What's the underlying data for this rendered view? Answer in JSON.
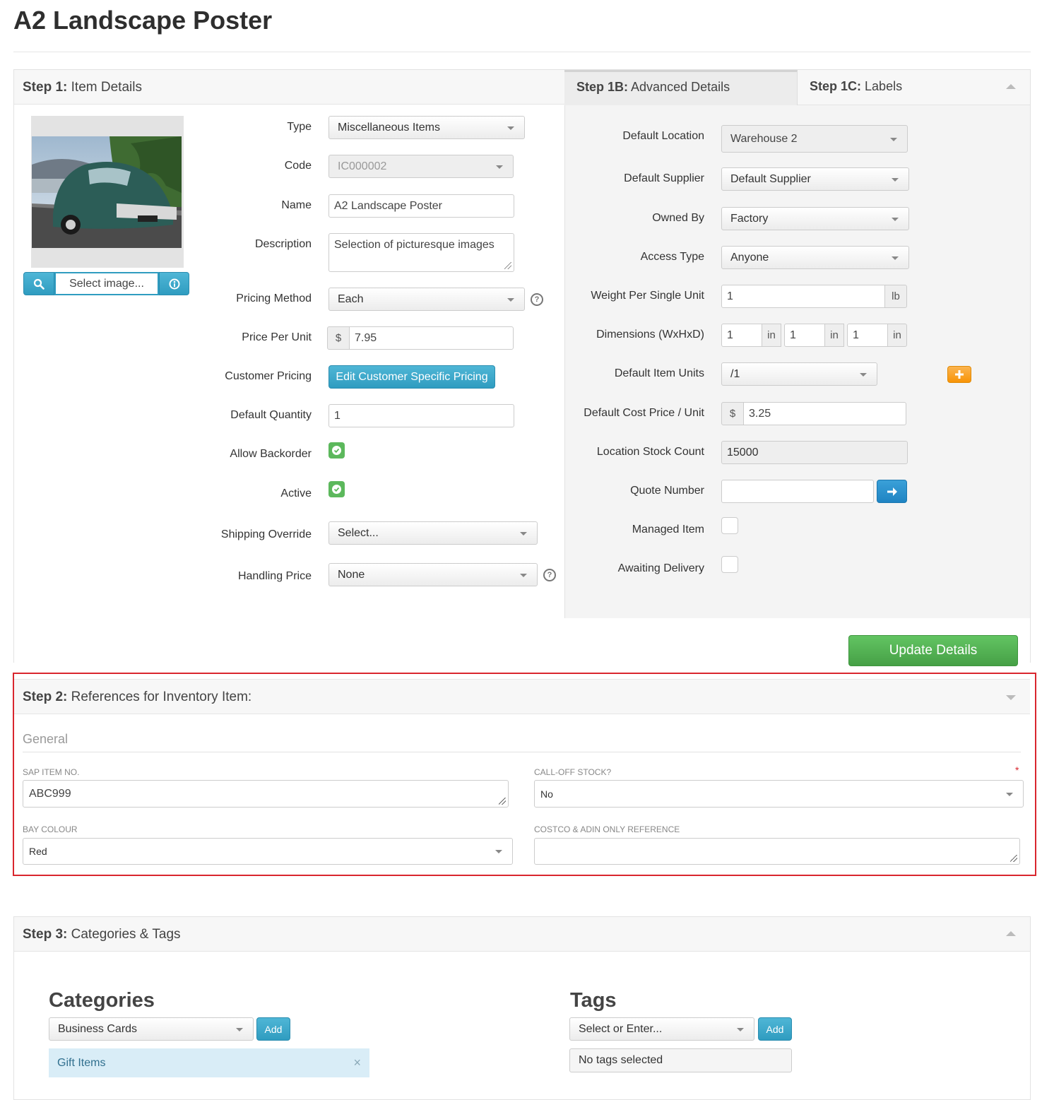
{
  "page": {
    "title": "A2 Landscape Poster"
  },
  "step1": {
    "heading_bold": "Step 1:",
    "heading_text": "Item Details",
    "image": {
      "placeholder": "Select image..."
    },
    "fields": {
      "type": {
        "label": "Type",
        "value": "Miscellaneous Items"
      },
      "code": {
        "label": "Code",
        "value": "IC000002"
      },
      "name": {
        "label": "Name",
        "value": "A2 Landscape Poster"
      },
      "description": {
        "label": "Description",
        "value": "Selection of picturesque images"
      },
      "pricing_method": {
        "label": "Pricing Method",
        "value": "Each"
      },
      "price_per_unit": {
        "label": "Price Per Unit",
        "currency": "$",
        "value": "7.95"
      },
      "customer_pricing": {
        "label": "Customer Pricing",
        "button": "Edit Customer Specific Pricing"
      },
      "default_quantity": {
        "label": "Default Quantity",
        "value": "1"
      },
      "allow_backorder": {
        "label": "Allow Backorder",
        "checked": true
      },
      "active": {
        "label": "Active",
        "checked": true
      },
      "shipping_override": {
        "label": "Shipping Override",
        "value": "Select..."
      },
      "handling_price": {
        "label": "Handling Price",
        "value": "None"
      }
    }
  },
  "step1b": {
    "tab_bold": "Step 1B:",
    "tab_text": "Advanced Details",
    "fields": {
      "default_location": {
        "label": "Default Location",
        "value": "Warehouse 2"
      },
      "default_supplier": {
        "label": "Default Supplier",
        "value": "Default Supplier"
      },
      "owned_by": {
        "label": "Owned By",
        "value": "Factory"
      },
      "access_type": {
        "label": "Access Type",
        "value": "Anyone"
      },
      "weight": {
        "label": "Weight Per Single Unit",
        "value": "1",
        "unit": "lb"
      },
      "dimensions": {
        "label": "Dimensions (WxHxD)",
        "w": "1",
        "h": "1",
        "d": "1",
        "unit": "in"
      },
      "default_item_units": {
        "label": "Default Item Units",
        "value": "/1"
      },
      "default_cost": {
        "label": "Default Cost Price / Unit",
        "currency": "$",
        "value": "3.25"
      },
      "stock_count": {
        "label": "Location Stock Count",
        "value": "15000"
      },
      "quote_number": {
        "label": "Quote Number",
        "value": ""
      },
      "managed_item": {
        "label": "Managed Item",
        "checked": false
      },
      "awaiting_delivery": {
        "label": "Awaiting Delivery",
        "checked": false
      }
    }
  },
  "step1c": {
    "tab_bold": "Step 1C:",
    "tab_text": "Labels"
  },
  "update_button": "Update Details",
  "step2": {
    "heading_bold": "Step 2:",
    "heading_text": "References for Inventory Item:",
    "group": "General",
    "sap_item_no": {
      "label": "SAP ITEM NO.",
      "value": "ABC999"
    },
    "call_off_stock": {
      "label": "CALL-OFF STOCK?",
      "value": "No",
      "required": "*"
    },
    "bay_colour": {
      "label": "BAY COLOUR",
      "value": "Red"
    },
    "costco_ref": {
      "label": "COSTCO & ADIN ONLY REFERENCE",
      "value": ""
    }
  },
  "step3": {
    "heading_bold": "Step 3:",
    "heading_text": "Categories & Tags",
    "categories": {
      "title": "Categories",
      "select_value": "Business Cards",
      "add_label": "Add",
      "items": [
        "Gift Items"
      ]
    },
    "tags": {
      "title": "Tags",
      "select_value": "Select or Enter...",
      "add_label": "Add",
      "empty_text": "No tags selected"
    }
  },
  "colors": {
    "accent_info": "#31a2c7",
    "success": "#5cb85c",
    "warning": "#f89406",
    "highlight_border": "#d9262e"
  }
}
